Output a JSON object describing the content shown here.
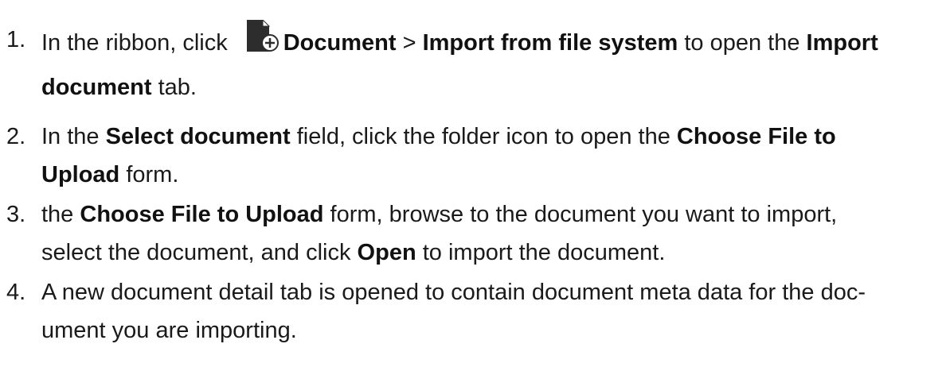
{
  "steps": [
    {
      "number": "1.",
      "parts": {
        "a": "In the ribbon, click",
        "b": "Document",
        "c": " > ",
        "d": "Import from file system",
        "e": " to open the ",
        "f": "Import",
        "g": "document",
        "h": " tab."
      }
    },
    {
      "number": "2.",
      "parts": {
        "a": "In the ",
        "b": "Select document",
        "c": " field, click the folder icon to open the ",
        "d": "Choose File to",
        "e": "Upload",
        "f": " form."
      }
    },
    {
      "number": "3.",
      "parts": {
        "a": "the ",
        "b": "Choose File to Upload",
        "c": " form, browse to the document you want to import,",
        "d": "select the document, and click ",
        "e": "Open",
        "f": " to import the document."
      }
    },
    {
      "number": "4.",
      "parts": {
        "a": "A new document detail tab is opened to contain document meta data for the doc-",
        "b": "ument you are importing."
      }
    }
  ],
  "icons": {
    "document_icon": "document-add-icon"
  },
  "colors": {
    "text": "#1a1a1a",
    "icon_dark": "#2d2d2d"
  }
}
